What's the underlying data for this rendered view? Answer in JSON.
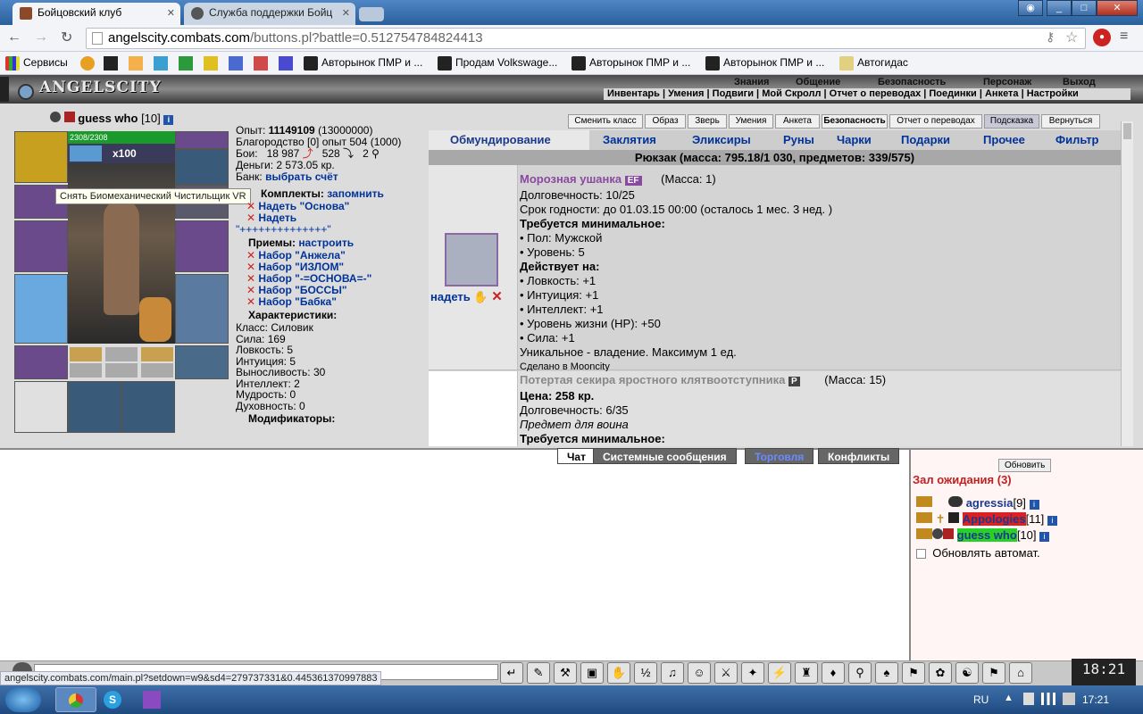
{
  "browser": {
    "tabs": [
      {
        "title": "Бойцовский клуб"
      },
      {
        "title": "Служба поддержки Бойц"
      }
    ],
    "address": {
      "host": "angelscity.combats.com",
      "path": "/buttons.pl?battle=0.512754784824413"
    },
    "bookmarks": [
      {
        "label": "Сервисы"
      },
      {
        "label": "Авторынок ПМР и ..."
      },
      {
        "label": "Продам Volkswage..."
      },
      {
        "label": "Авторынок ПМР и ..."
      },
      {
        "label": "Авторынок ПМР и ..."
      },
      {
        "label": "Автогидас"
      }
    ],
    "status_url": "angelscity.combats.com/main.pl?setdown=w9&sd4=279737331&0.445361370997883"
  },
  "game": {
    "logo": "ANGELSCITY",
    "top_menu": [
      "Знания",
      "Общение",
      "Безопасность",
      "Персонаж",
      "Выход"
    ],
    "sub_menu": "Инвентарь | Умения | Подвиги | Мой Скролл | Отчет о переводах | Поединки | Анкета | Настройки",
    "character": {
      "name": "guess who",
      "level": "[10]",
      "hp": "2308/2308",
      "buff_count": "x100",
      "tooltip": "Снять Биомеханический Чистильщик VR"
    },
    "stats": {
      "exp_label": "Опыт:",
      "exp_value": "11149109",
      "exp_next": "(13000000)",
      "nobility": "Благородство [0] опыт 504 (1000)",
      "battles_label": "Бои:",
      "battles_wins": "18 987",
      "battles_losses": "528",
      "battles_draws": "2",
      "money": "Деньги: 2 573.05 кр.",
      "bank_label": "Банк:",
      "bank_link": "выбрать счёт",
      "sets_label": "Комплекты:",
      "sets_remember": "запомнить",
      "sets": [
        "Надеть \"Основа\"",
        "Надеть"
      ],
      "sets_extra": "\"++++++++++++++\"",
      "tricks_label": "Приемы:",
      "tricks_config": "настроить",
      "tricks": [
        "Набор \"Анжела\"",
        "Набор \"ИЗЛОМ\"",
        "Набор \"-=ОСНОВА=-\"",
        "Набор \"БОССЫ\"",
        "Набор \"Бабка\""
      ],
      "chars_label": "Характеристики:",
      "class": "Класс: Силовик",
      "str": "Сила: 169",
      "agi": "Ловкость: 5",
      "int": "Интуиция: 5",
      "end": "Выносливость: 30",
      "intel": "Интеллект: 2",
      "wis": "Мудрость: 0",
      "spirit": "Духовность: 0",
      "mods_label": "Модификаторы:"
    },
    "right_buttons": [
      "Сменить класс",
      "Образ",
      "Зверь",
      "Умения",
      "Анкета",
      "Безопасность",
      "Отчет о переводах",
      "Подсказка",
      "Вернуться"
    ],
    "inv_tabs": [
      "Обмундирование",
      "Заклятия",
      "Эликсиры",
      "Руны",
      "Чарки",
      "Подарки",
      "Прочее",
      "Фильтр"
    ],
    "bag_title": "Рюкзак (масса: 795.18/1 030, предметов: 339/575)",
    "items": [
      {
        "name": "Морозная ушанка",
        "badge": "EF",
        "mass": "(Масса: 1)",
        "action": "надеть",
        "lines": [
          "Долговечность: 10/25",
          "Срок годности: до 01.03.15 00:00 (осталось 1 мес. 3 нед. )",
          "Требуется минимальное:",
          "• Пол: Мужской",
          "• Уровень: 5",
          "Действует на:",
          "• Ловкость: +1",
          "• Интуиция: +1",
          "• Интеллект: +1",
          "• Уровень жизни (HP): +50",
          "• Сила: +1",
          "Уникальное - владение. Максимум 1 ед.",
          "Сделано в Mooncity"
        ]
      },
      {
        "name": "Потертая секира яростного клятвоотступника",
        "badge": "P",
        "mass": "(Масса: 15)",
        "lines": [
          "Цена: 258 кр.",
          "Долговечность: 6/35",
          "Предмет для воина",
          "Требуется минимальное:"
        ]
      }
    ],
    "chat_tabs": [
      "Чат",
      "Системные сообщения",
      "Торговля",
      "Конфликты"
    ],
    "wait_room": {
      "refresh": "Обновить",
      "title": "Зал ожидания (3)",
      "players": [
        {
          "name": "agressia",
          "level": "[9]"
        },
        {
          "name": "Appologies",
          "level": "[11]"
        },
        {
          "name": "guess who",
          "level": "[10]"
        }
      ],
      "auto_refresh": "Обновлять автомат."
    },
    "clock": "18:21"
  },
  "taskbar": {
    "lang": "RU",
    "time": "17:21"
  }
}
